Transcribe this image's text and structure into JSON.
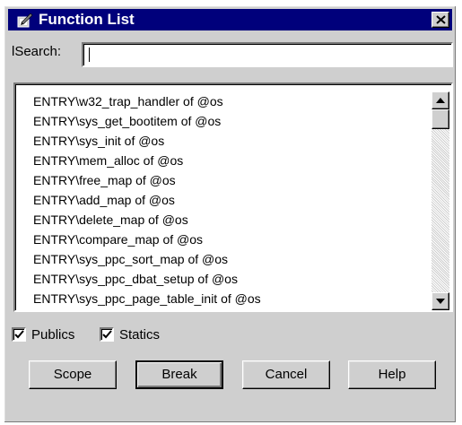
{
  "window": {
    "title": "Function List",
    "icon": "function-list-icon",
    "close_icon": "close-icon"
  },
  "search": {
    "label": "lSearch:",
    "value": ""
  },
  "list": {
    "items": [
      "ENTRY\\w32_trap_handler of @os",
      "ENTRY\\sys_get_bootitem of @os",
      "ENTRY\\sys_init of @os",
      "ENTRY\\mem_alloc of @os",
      "ENTRY\\free_map of @os",
      "ENTRY\\add_map of @os",
      "ENTRY\\delete_map of @os",
      "ENTRY\\compare_map of @os",
      "ENTRY\\sys_ppc_sort_map of @os",
      "ENTRY\\sys_ppc_dbat_setup of @os",
      "ENTRY\\sys_ppc_page_table_init of @os"
    ]
  },
  "checkboxes": {
    "publics": {
      "label": "Publics",
      "checked": true
    },
    "statics": {
      "label": "Statics",
      "checked": true
    }
  },
  "buttons": {
    "scope": "Scope",
    "break": "Break",
    "cancel": "Cancel",
    "help": "Help"
  },
  "colors": {
    "titlebar": "#00007b",
    "face": "#cfcfcf"
  }
}
